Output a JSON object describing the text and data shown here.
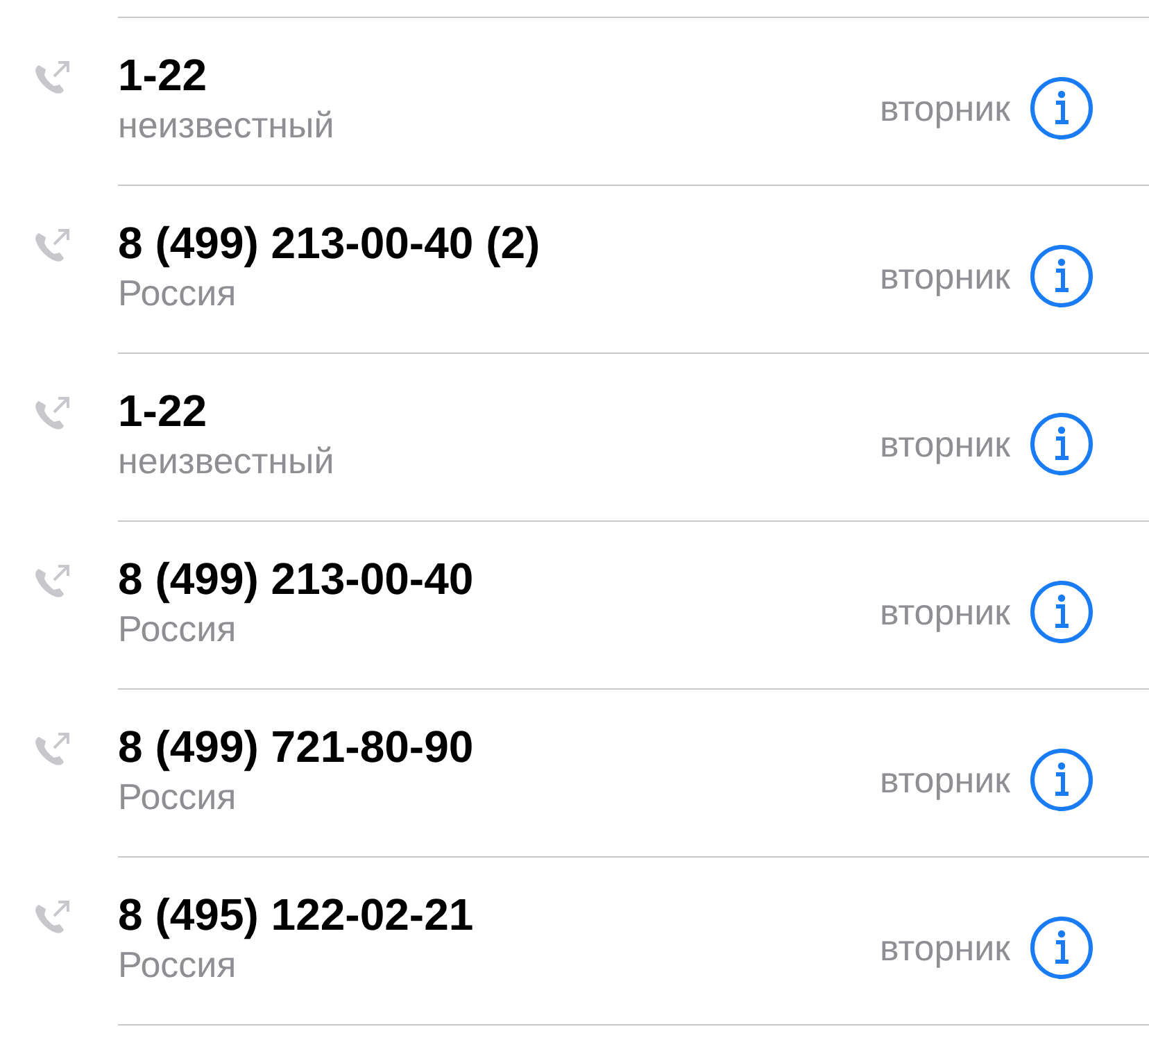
{
  "calls": [
    {
      "number": "1-22",
      "label": "неизвестный",
      "day": "вторник"
    },
    {
      "number": "8 (499) 213-00-40 (2)",
      "label": "Россия",
      "day": "вторник"
    },
    {
      "number": "1-22",
      "label": "неизвестный",
      "day": "вторник"
    },
    {
      "number": "8 (499) 213-00-40",
      "label": "Россия",
      "day": "вторник"
    },
    {
      "number": "8 (499) 721-80-90",
      "label": "Россия",
      "day": "вторник"
    },
    {
      "number": "8 (495) 122-02-21",
      "label": "Россия",
      "day": "вторник"
    }
  ]
}
